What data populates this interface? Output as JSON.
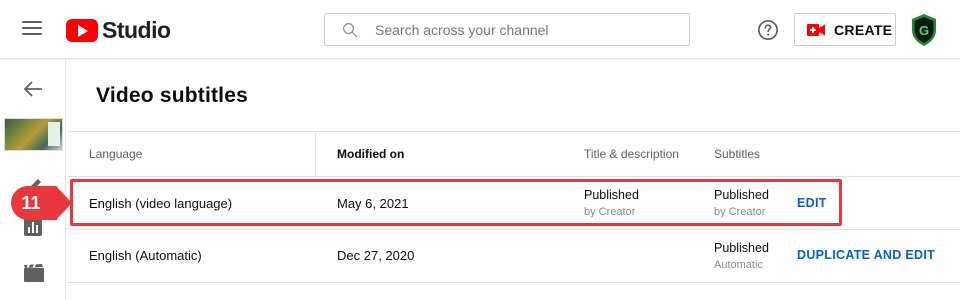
{
  "header": {
    "logo_text": "Studio",
    "search": {
      "placeholder": "Search across your channel",
      "value": ""
    },
    "create_label": "CREATE",
    "avatar_letter": "G"
  },
  "page": {
    "title": "Video subtitles"
  },
  "table": {
    "columns": [
      "Language",
      "Modified on",
      "Title & description",
      "Subtitles"
    ],
    "rows": [
      {
        "language": "English (video language)",
        "modified": "May 6, 2021",
        "title_status": "Published",
        "title_by": "by Creator",
        "subtitles_status": "Published",
        "subtitles_by": "by Creator",
        "action": "EDIT"
      },
      {
        "language": "English (Automatic)",
        "modified": "Dec 27, 2020",
        "title_status": "",
        "title_by": "",
        "subtitles_status": "Published",
        "subtitles_by": "Automatic",
        "action": "DUPLICATE AND EDIT"
      }
    ]
  },
  "annotation": {
    "step_number": "11",
    "color": "#e8383d"
  },
  "colors": {
    "brand_red": "#ff0000",
    "link_blue": "#065fd4",
    "annotation_red": "#e8383d"
  },
  "icons": [
    "menu-icon",
    "youtube-logo-icon",
    "search-icon",
    "help-icon",
    "create-video-icon",
    "avatar-icon",
    "back-arrow-icon",
    "pencil-icon",
    "analytics-icon",
    "film-icon"
  ]
}
